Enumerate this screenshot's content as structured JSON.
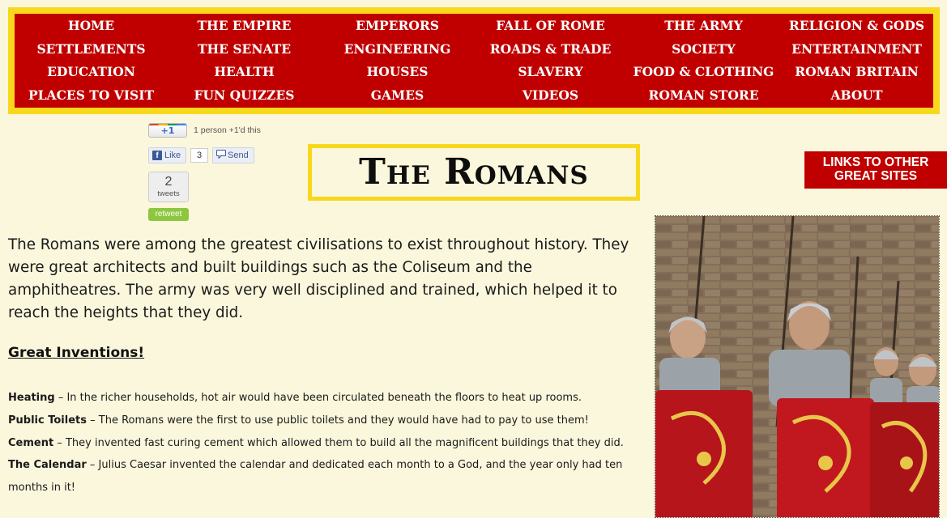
{
  "nav": {
    "items": [
      "HOME",
      "THE EMPIRE",
      "EMPERORS",
      "FALL OF ROME",
      "THE ARMY",
      "RELIGION & GODS",
      "SETTLEMENTS",
      "THE SENATE",
      "ENGINEERING",
      "ROADS & TRADE",
      "SOCIETY",
      "ENTERTAINMENT",
      "EDUCATION",
      "HEALTH",
      "HOUSES",
      "SLAVERY",
      "FOOD & CLOTHING",
      "ROMAN BRITAIN",
      "PLACES TO VISIT",
      "FUN QUIZZES",
      "GAMES",
      "VIDEOS",
      "ROMAN STORE",
      "ABOUT"
    ]
  },
  "social": {
    "gplus_label": "+1",
    "gplus_text": "1 person +1'd this",
    "fb_like_label": "Like",
    "fb_like_count": "3",
    "fb_send_label": "Send",
    "tweet_count": "2",
    "tweet_label": "tweets",
    "retweet_label": "retweet"
  },
  "title": "The Romans",
  "links_button": "LINKS TO OTHER GREAT SITES",
  "intro": "The Romans were among the greatest civilisations to exist throughout history. They were great architects and built buildings such as the Coliseum and the amphitheatres. The army was very well disciplined and trained, which helped it to reach the heights that they did.",
  "inventions": {
    "heading": "Great Inventions!",
    "items": [
      {
        "term": "Heating",
        "text": " – In the richer households, hot air would have been circulated beneath the floors to heat up rooms."
      },
      {
        "term": "Public Toilets",
        "text": " – The Romans were the first to use public toilets and they would have had to pay to use them!"
      },
      {
        "term": "Cement",
        "text": " – They invented fast curing cement which allowed them to build all the magnificent buildings that they did."
      },
      {
        "term": "The Calendar",
        "text": " – Julius Caesar invented the calendar and dedicated each month to a God, and the year only had ten months in it!"
      }
    ]
  },
  "colors": {
    "nav_border": "#f9d71c",
    "nav_bg": "#c00000",
    "page_bg": "#fbf7dc"
  }
}
